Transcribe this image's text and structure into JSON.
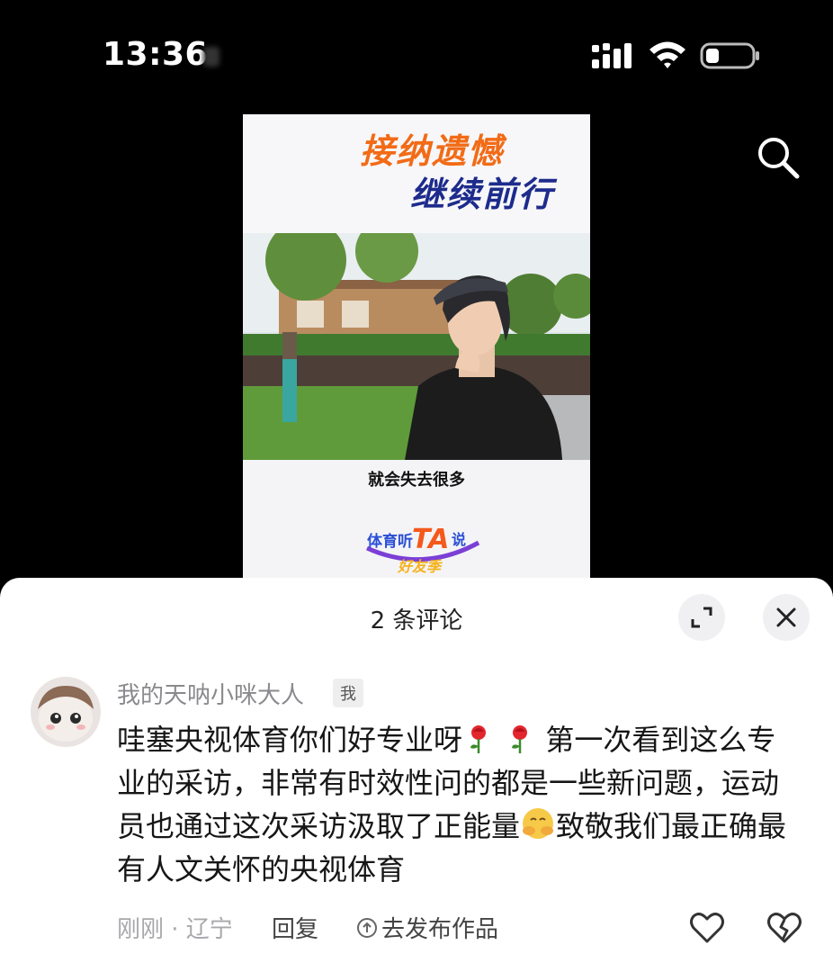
{
  "status_bar": {
    "time": "13:36"
  },
  "video": {
    "title_line1": "接纳遗憾",
    "title_line2": "继续前行",
    "caption": "就会失去很多",
    "logo_text_top": "体育听",
    "logo_text_ta": "TA",
    "logo_text_shuo": "说",
    "logo_text_bottom": "好友季"
  },
  "comments_panel": {
    "title": "2 条评论",
    "comment": {
      "username": "我的天呐小咪大人",
      "badge": "我",
      "text_part1": "哇塞央视体育你们好专业呀",
      "text_part2": "第一次看到这么专业的采访，非常有时效性问的都是一些新问题，运动员也通过这次采访汲取了正能量",
      "text_part3": "致敬我们最正确最有人文关怀的央视体育",
      "time_location": "刚刚 · 辽宁",
      "reply_label": "回复",
      "publish_label": "去发布作品"
    }
  },
  "colors": {
    "title_orange": "#f26b16",
    "title_navy": "#1d2b8c",
    "sheet_bg": "#ffffff"
  }
}
